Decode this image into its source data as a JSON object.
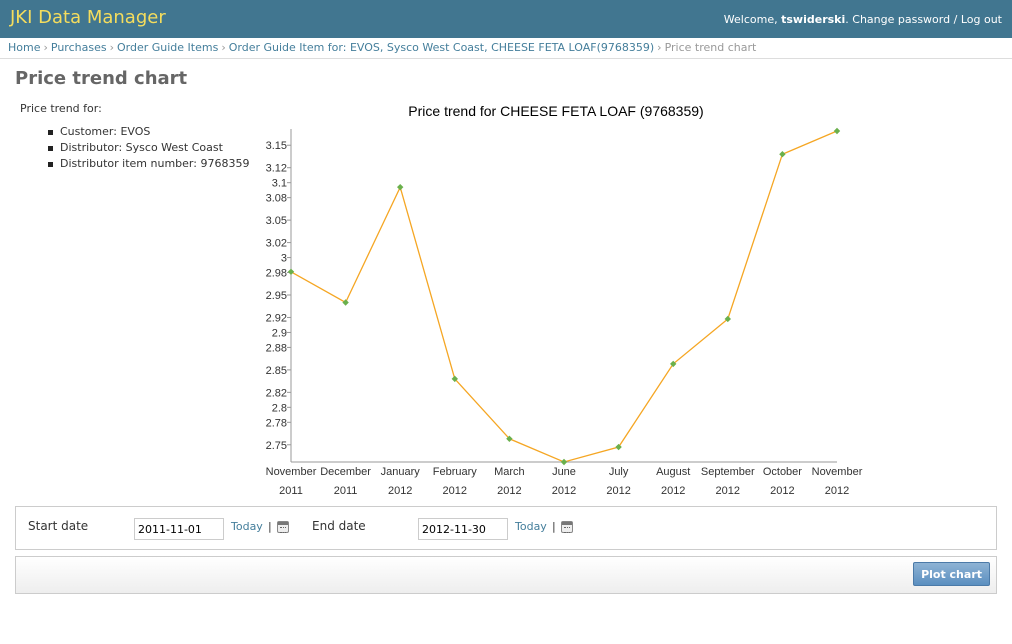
{
  "header": {
    "brand": "JKI Data Manager",
    "welcome": "Welcome,",
    "username": "tswiderski",
    "change_password": "Change password",
    "tools_sep": "/",
    "logout": "Log out"
  },
  "breadcrumbs": {
    "sep": "›",
    "items": [
      {
        "label": "Home"
      },
      {
        "label": "Purchases"
      },
      {
        "label": "Order Guide Items"
      },
      {
        "label": "Order Guide Item for: EVOS, Sysco West Coast, CHEESE FETA LOAF(9768359)"
      }
    ],
    "current": "Price trend chart"
  },
  "page": {
    "title": "Price trend chart"
  },
  "info": {
    "lead": "Price trend for:",
    "items": [
      "Customer: EVOS",
      "Distributor: Sysco West Coast",
      "Distributor item number: 9768359"
    ]
  },
  "chart_data": {
    "type": "line",
    "title": "Price trend for CHEESE FETA LOAF (9768359)",
    "xlabel": "",
    "ylabel": "",
    "categories": [
      [
        "November",
        "2011"
      ],
      [
        "December",
        "2011"
      ],
      [
        "January",
        "2012"
      ],
      [
        "February",
        "2012"
      ],
      [
        "March",
        "2012"
      ],
      [
        "June",
        "2012"
      ],
      [
        "July",
        "2012"
      ],
      [
        "August",
        "2012"
      ],
      [
        "September",
        "2012"
      ],
      [
        "October",
        "2012"
      ],
      [
        "November",
        "2012"
      ]
    ],
    "series": [
      {
        "values": [
          2.981,
          2.94,
          3.094,
          2.838,
          2.758,
          2.727,
          2.747,
          2.858,
          2.918,
          3.138,
          3.169
        ],
        "color": "#f5a623",
        "marker_color": "#6ab04c"
      }
    ],
    "yticks": [
      "2.75",
      "2.78",
      "2.8",
      "2.82",
      "2.85",
      "2.88",
      "2.9",
      "2.92",
      "2.95",
      "2.98",
      "3",
      "3.02",
      "3.05",
      "3.08",
      "3.1",
      "3.12",
      "3.15"
    ],
    "ylim": [
      2.727,
      3.169
    ],
    "grid": false,
    "legend": "none"
  },
  "date_panel": {
    "start_label": "Start date",
    "start_value": "2011-11-01",
    "end_label": "End date",
    "end_value": "2012-11-30",
    "today": "Today",
    "sep": "|",
    "calendar_icon": "calendar-icon"
  },
  "actions": {
    "plot_label": "Plot chart"
  },
  "colors": {
    "header_bg": "#417690",
    "brand": "#f5dd5d",
    "link": "#447e9b",
    "button": "#5b8fc0"
  }
}
